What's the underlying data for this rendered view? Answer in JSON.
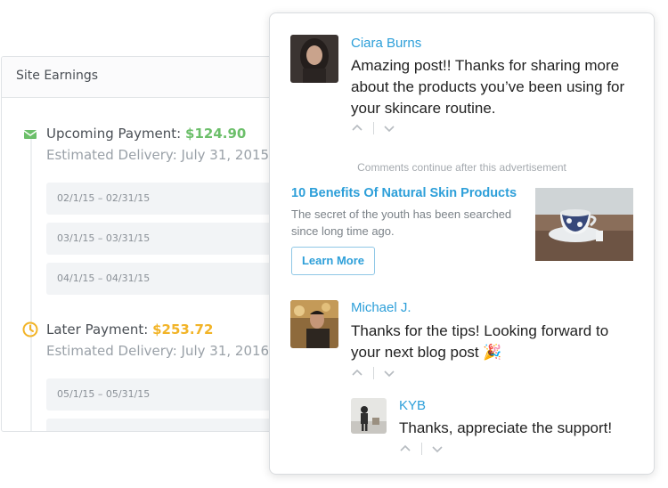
{
  "earnings": {
    "title": "Site Earnings",
    "upcoming": {
      "label": "Upcoming Payment:",
      "amount": "$124.90",
      "delivery": "Estimated Delivery: July 31, 2015",
      "ranges": [
        "02/1/15 – 02/31/15",
        "03/1/15 – 03/31/15",
        "04/1/15 – 04/31/15"
      ]
    },
    "later": {
      "label": "Later Payment:",
      "amount": "$253.72",
      "delivery": "Estimated Delivery: July 31, 2016",
      "ranges": [
        "05/1/15 – 05/31/15"
      ]
    },
    "colors": {
      "green": "#6cbf6a",
      "yellow": "#f2b428"
    }
  },
  "comments": [
    {
      "author": "Ciara Burns",
      "text": "Amazing post!! Thanks for sharing more about the products you’ve been using for your skincare routine."
    },
    {
      "author": "Michael J.",
      "text": "Thanks for the tips! Looking forward to your next blog post 🎉"
    },
    {
      "author": "KYB",
      "text": "Thanks, appreciate the support!"
    }
  ],
  "ad": {
    "notice": "Comments continue after this advertisement",
    "title": "10 Benefits Of Natural Skin Products",
    "description": "The secret of the youth has been searched since long time ago.",
    "button": "Learn More"
  },
  "icons": {
    "upcoming": "envelope-icon",
    "later": "clock-icon",
    "upvote": "chevron-up-icon",
    "downvote": "chevron-down-icon"
  },
  "accent_color": "#2d9fd9"
}
